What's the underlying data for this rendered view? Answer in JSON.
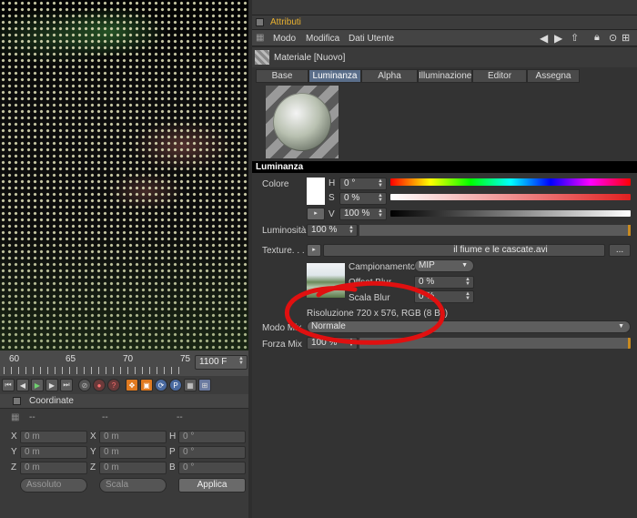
{
  "viewport": {},
  "timeline": {
    "ticks": [
      "60",
      "65",
      "70",
      "75"
    ],
    "frame": "1100 F"
  },
  "coordinates": {
    "title": "Coordinate",
    "col_headers": [
      "--",
      "--",
      "--"
    ],
    "rows": [
      {
        "a": "X",
        "av": "0 m",
        "b": "X",
        "bv": "0 m",
        "c": "H",
        "cv": "0 °"
      },
      {
        "a": "Y",
        "av": "0 m",
        "b": "Y",
        "bv": "0 m",
        "c": "P",
        "cv": "0 °"
      },
      {
        "a": "Z",
        "av": "0 m",
        "b": "Z",
        "bv": "0 m",
        "c": "B",
        "cv": "0 °"
      }
    ],
    "mode1": "Assoluto",
    "mode2": "Scala",
    "apply": "Applica"
  },
  "attributes": {
    "title": "Attributi",
    "menu": [
      "Modo",
      "Modifica",
      "Dati Utente"
    ],
    "material": "Materiale [Nuovo]",
    "tabs": [
      "Base",
      "Luminanza",
      "Alpha",
      "Illuminazione",
      "Editor",
      "Assegna"
    ],
    "active_tab": "Luminanza",
    "section": "Luminanza",
    "color_label": "Colore",
    "h_label": "H",
    "h_value": "0 °",
    "s_label": "S",
    "s_value": "0 %",
    "v_label": "V",
    "v_value": "100 %",
    "brightness_label": "Luminosità",
    "brightness_value": "100 %",
    "texture_label": "Texture. . .",
    "texture_file": "il fiume e le cascate.avi",
    "texture_more": "...",
    "sampling_label": "Campionamento",
    "sampling_value": "MIP",
    "offset_blur_label": "Offset Blur",
    "offset_blur_value": "0 %",
    "scale_blur_label": "Scala Blur",
    "scale_blur_value": "0 %",
    "resolution": "Risoluzione 720 x 576, RGB (8 Bit)",
    "mix_mode_label": "Modo Mix",
    "mix_mode_value": "Normale",
    "mix_strength_label": "Forza Mix",
    "mix_strength_value": "100 %",
    "brightness_fill": 1.0,
    "colors": {
      "accent_title": "#e8b030",
      "tab_active": "#5a6e8a",
      "annotation": "#e01010"
    }
  }
}
